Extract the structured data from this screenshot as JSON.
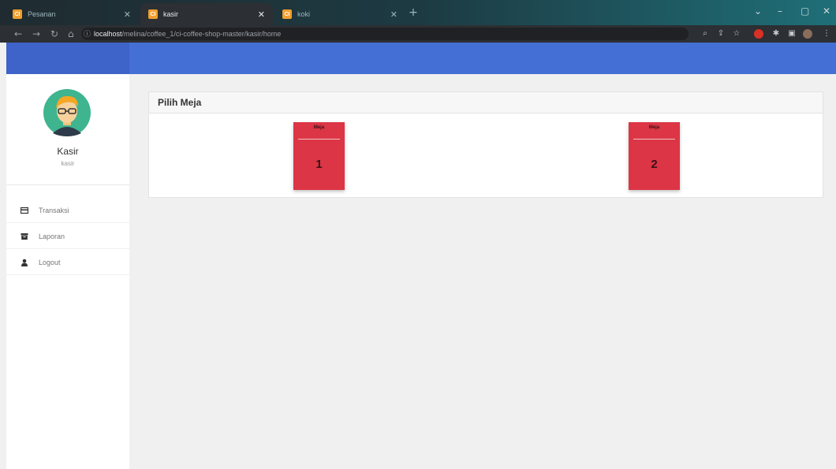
{
  "browser": {
    "tabs": [
      {
        "title": "Pesanan",
        "favicon": "CI"
      },
      {
        "title": "kasir",
        "favicon": "CI"
      },
      {
        "title": "koki",
        "favicon": "CI"
      }
    ],
    "url_host": "localhost",
    "url_path": "/melina/coffee_1/ci-coffee-shop-master/kasir/home"
  },
  "sidebar": {
    "user_name": "Kasir",
    "user_role": "kasir",
    "items": [
      {
        "label": "Transaksi",
        "icon": "credit-card-icon"
      },
      {
        "label": "Laporan",
        "icon": "archive-icon"
      },
      {
        "label": "Logout",
        "icon": "user-icon"
      }
    ]
  },
  "main": {
    "title": "Pilih Meja",
    "tables": [
      {
        "label": "Meja",
        "number": "1"
      },
      {
        "label": "Meja",
        "number": "2"
      }
    ]
  },
  "colors": {
    "header_blue": "#4470d5",
    "table_red": "#dc3545"
  }
}
